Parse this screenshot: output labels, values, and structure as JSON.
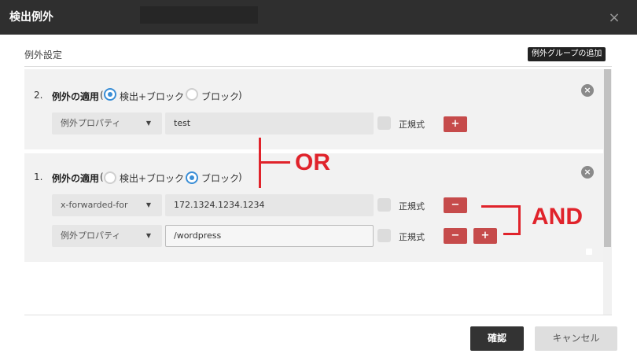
{
  "dialog": {
    "title": "検出例外",
    "close_icon": "close-icon"
  },
  "section": {
    "label": "例外設定",
    "add_group_label": "例外グループの追加"
  },
  "rules": [
    {
      "number": "2.",
      "apply_label": "例外の適用",
      "paren_open": "(",
      "paren_close": ")",
      "options": [
        {
          "label": "検出+ブロック",
          "selected": true
        },
        {
          "label": "ブロック",
          "selected": false
        }
      ],
      "conditions": [
        {
          "property": "例外プロパティ",
          "value": "test",
          "regex_label": "正規式",
          "regex_checked": false,
          "buttons": [
            "plus"
          ]
        }
      ]
    },
    {
      "number": "1.",
      "apply_label": "例外の適用",
      "paren_open": "(",
      "paren_close": ")",
      "options": [
        {
          "label": "検出+ブロック",
          "selected": false
        },
        {
          "label": "ブロック",
          "selected": true
        }
      ],
      "conditions": [
        {
          "property": "x-forwarded-for",
          "value": "172.1324.1234.1234",
          "regex_label": "正規式",
          "regex_checked": false,
          "buttons": [
            "minus"
          ]
        },
        {
          "property": "例外プロパティ",
          "value": "/wordpress",
          "regex_label": "正規式",
          "regex_checked": false,
          "buttons": [
            "minus",
            "plus"
          ]
        }
      ]
    }
  ],
  "buttons": {
    "plus_glyph": "+",
    "minus_glyph": "−",
    "remove_glyph": "×"
  },
  "annotations": {
    "or_text": "OR",
    "and_text": "AND",
    "color": "#e0232b"
  },
  "footer": {
    "confirm_label": "確認",
    "cancel_label": "キャンセル"
  },
  "colors": {
    "titlebar": "#2f2f2f",
    "radio_selected": "#3a8ed6",
    "red_button": "#c64b4b",
    "confirm_button": "#333333"
  }
}
